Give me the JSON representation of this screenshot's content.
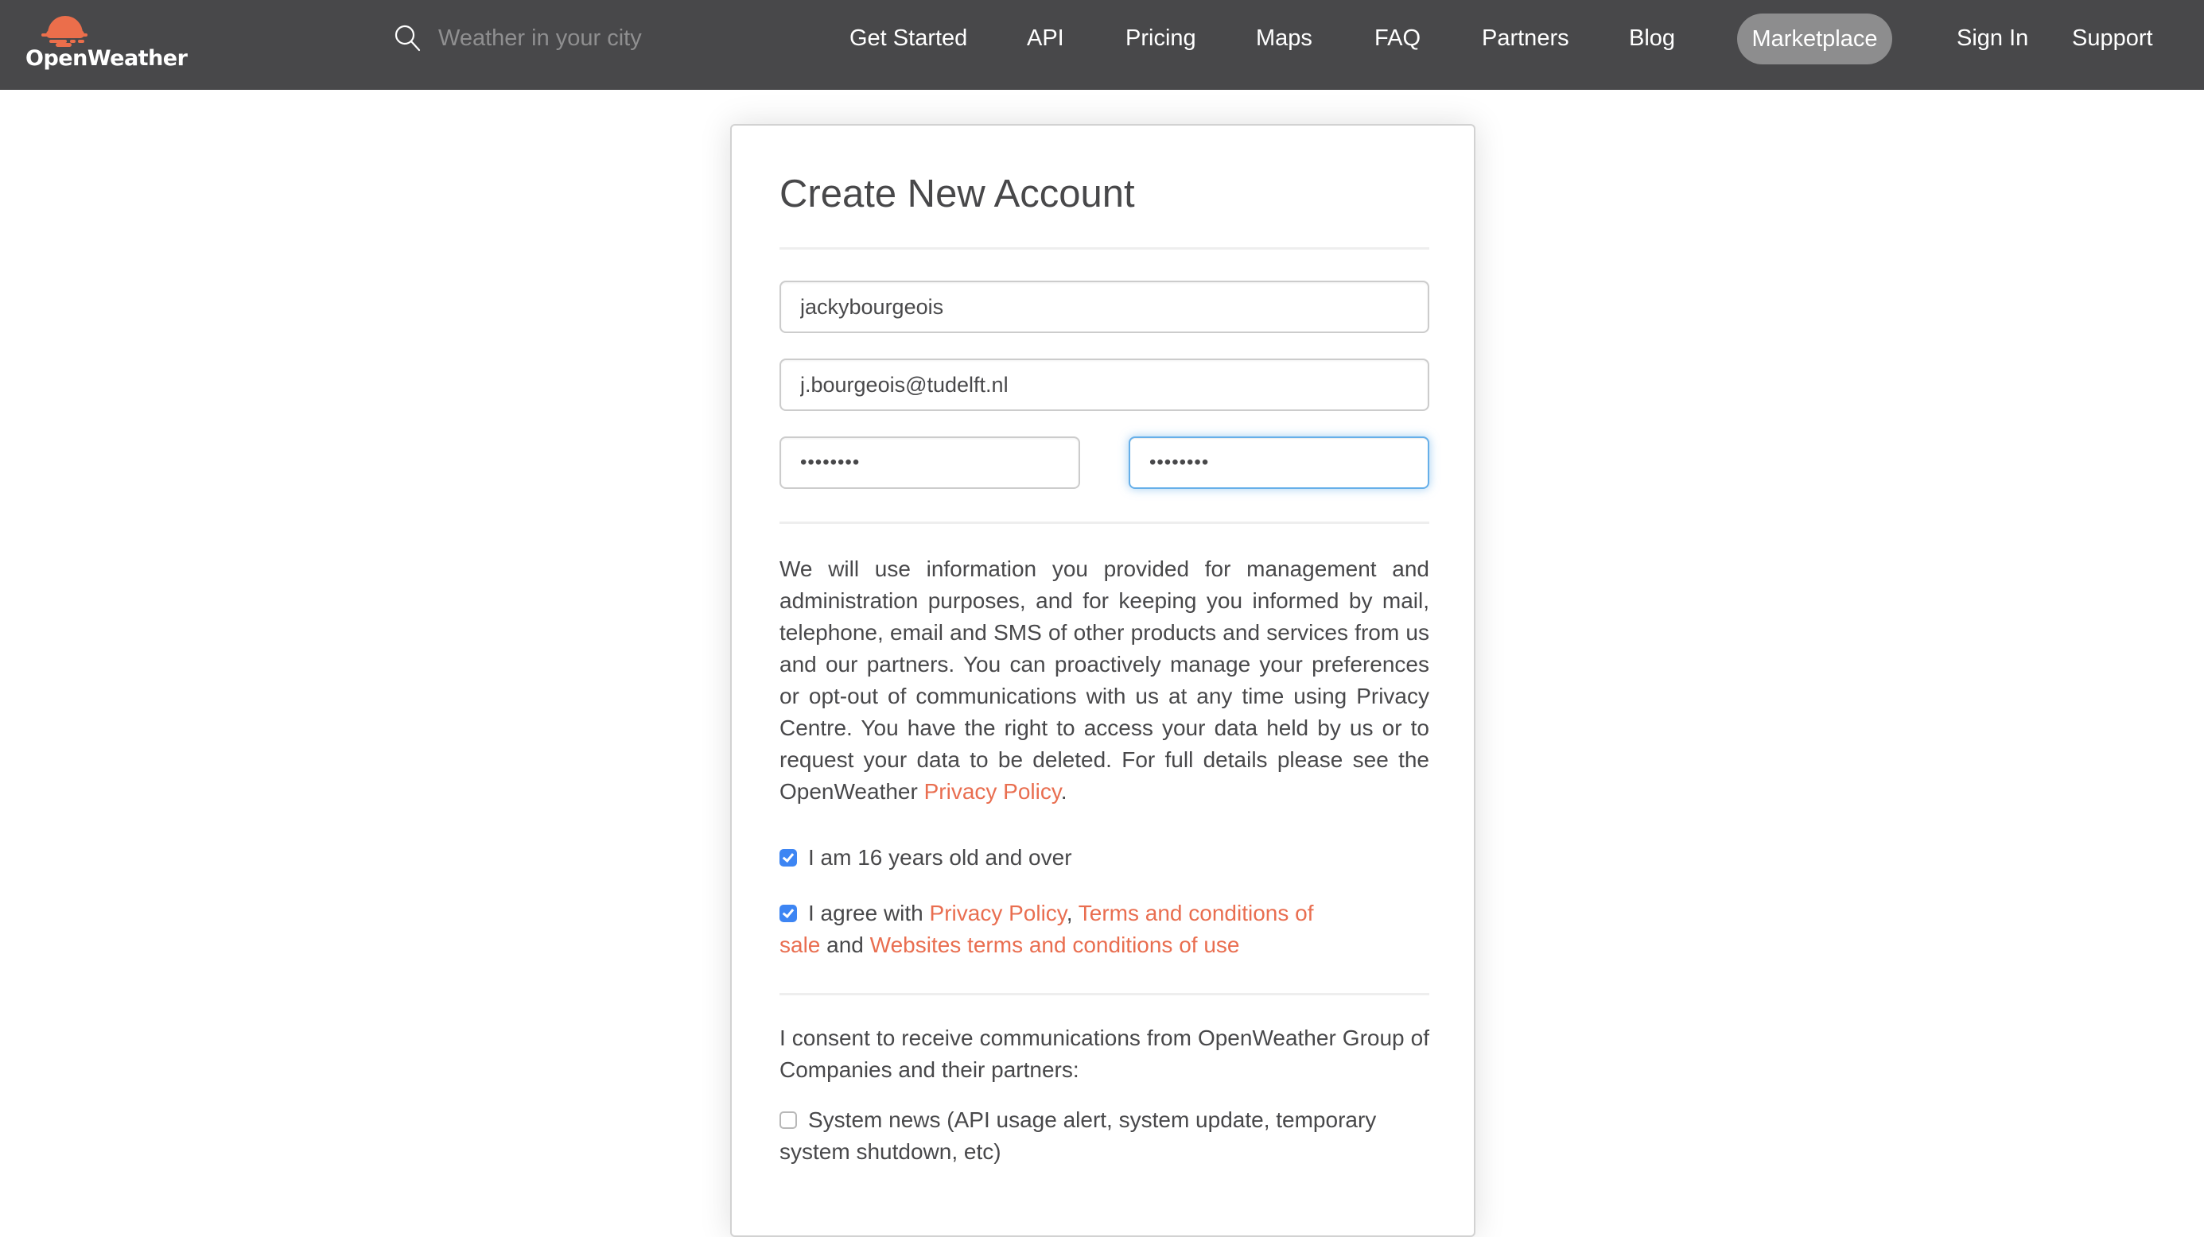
{
  "header": {
    "brand": "OpenWeather",
    "brand_color": "#eb6e4b",
    "search": {
      "placeholder": "Weather in your city",
      "value": "",
      "icon": "search-icon"
    },
    "nav": [
      {
        "label": "Get Started"
      },
      {
        "label": "API"
      },
      {
        "label": "Pricing"
      },
      {
        "label": "Maps"
      },
      {
        "label": "FAQ"
      },
      {
        "label": "Partners"
      },
      {
        "label": "Blog"
      },
      {
        "label": "Marketplace",
        "highlighted": true
      },
      {
        "label": "Sign In"
      },
      {
        "label": "Support"
      }
    ]
  },
  "form": {
    "title": "Create New Account",
    "username": {
      "value": "jackybourgeois"
    },
    "email": {
      "value": "j.bourgeois@tudelft.nl"
    },
    "password": {
      "value": "••••••••"
    },
    "password_confirm": {
      "value": "••••••••",
      "focused": true
    },
    "policy_text": "We will use information you provided for management and administration purposes, and for keeping you informed by mail, telephone, email and SMS of other products and services from us and our partners. You can proactively manage your preferences or opt-out of communications with us at any time using Privacy Centre. You have the right to access your data held by us or to request your data to be deleted. For full details please see the OpenWeather ",
    "policy_link": "Privacy Policy",
    "policy_end": ".",
    "age_check": {
      "label": "I am 16 years old and over",
      "checked": true
    },
    "agree_check": {
      "prefix": "I agree with ",
      "link1": "Privacy Policy",
      "sep1": ", ",
      "link2": "Terms and conditions of sale",
      "sep2": " and ",
      "link3": "Websites terms and conditions of use",
      "checked": true
    },
    "consent_text": "I consent to receive communications from OpenWeather Group of Companies and their partners:",
    "system_news": {
      "label": "System news (API usage alert, system update, temporary system shutdown, etc)",
      "checked": false
    }
  },
  "colors": {
    "header_bg": "#48484a",
    "link": "#e96e50",
    "checkbox": "#3d85f3",
    "focus": "#66afe9",
    "pill": "#8d8d8e"
  }
}
